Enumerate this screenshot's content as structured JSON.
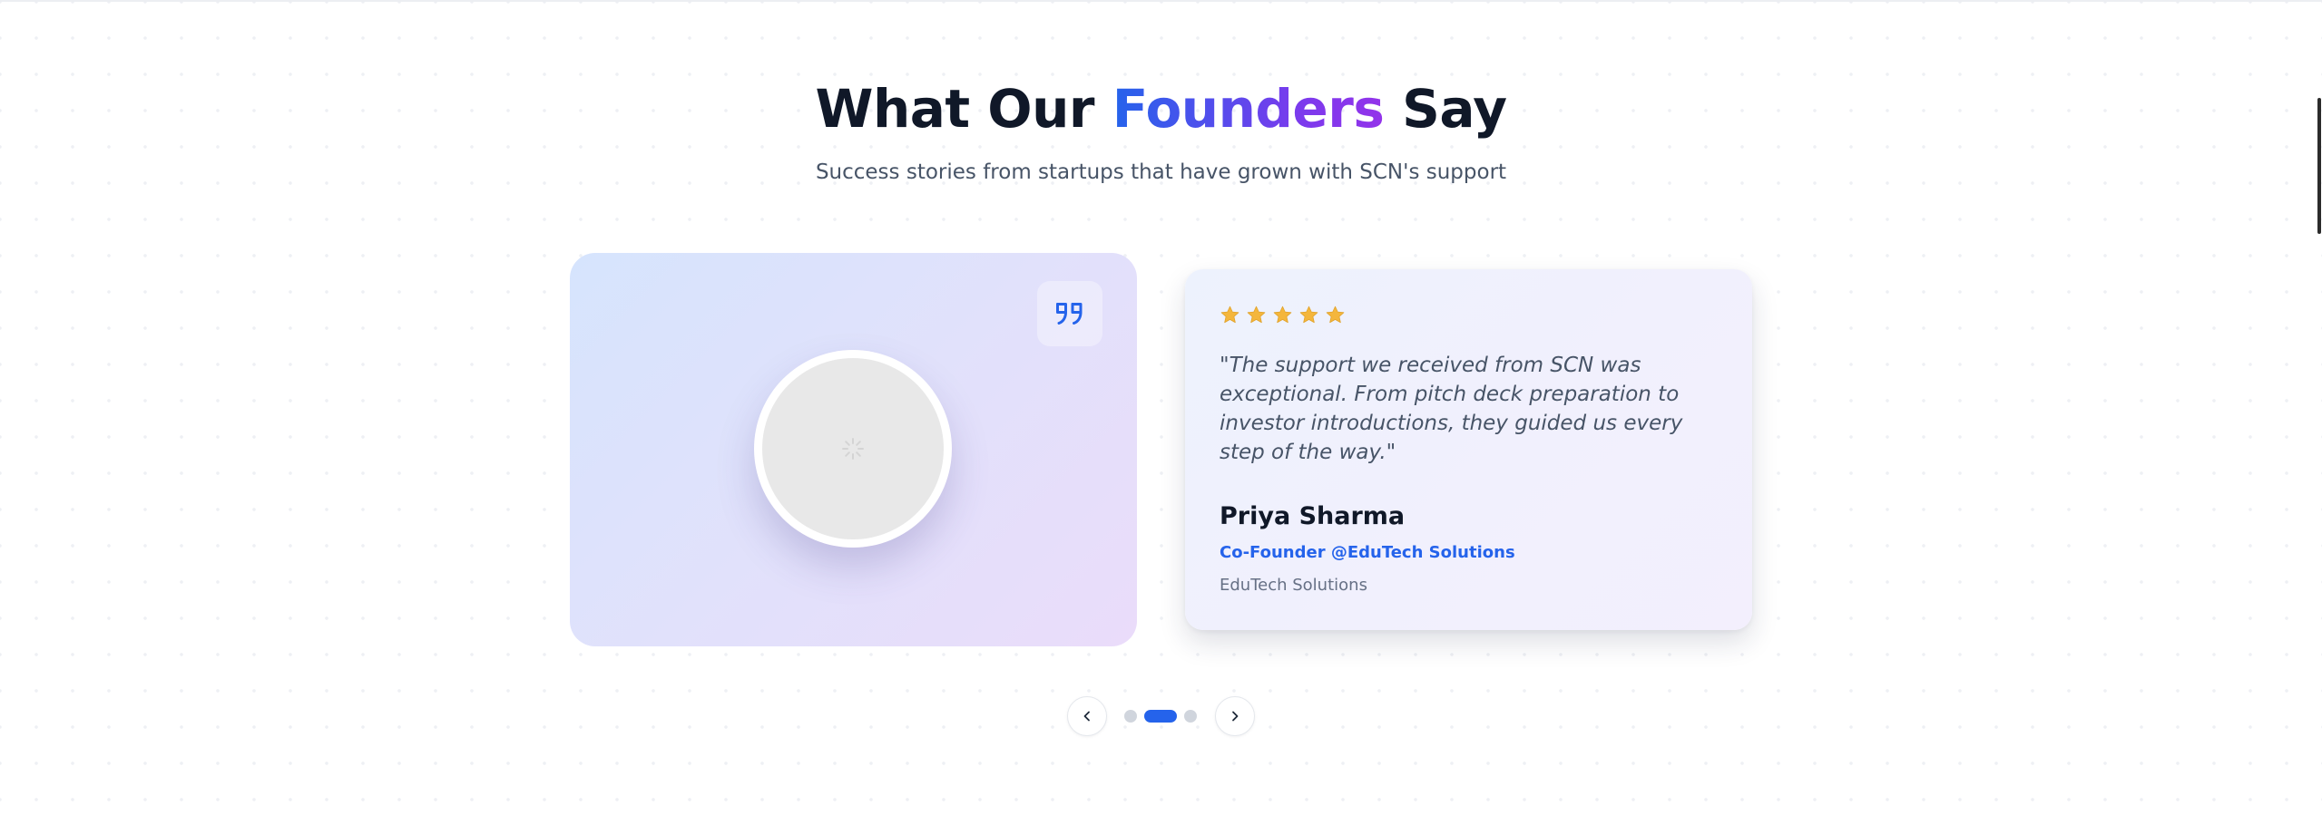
{
  "section": {
    "heading": {
      "before": "What Our ",
      "highlight": "Founders",
      "after": " Say"
    },
    "subtitle": "Success stories from startups that have grown with SCN's support"
  },
  "testimonial": {
    "rating": 5,
    "quote": "\"The support we received from SCN was exceptional. From pitch deck preparation to investor introductions, they guided us every step of the way.\"",
    "name": "Priya Sharma",
    "role": "Co-Founder @EduTech Solutions",
    "company": "EduTech Solutions"
  },
  "carousel": {
    "total_slides": 3,
    "active_slide": 2
  },
  "icons": {
    "quote": "quote-icon",
    "star": "star-icon",
    "prev": "chevron-left-icon",
    "next": "chevron-right-icon",
    "loading": "loading-spinner-icon"
  },
  "colors": {
    "accent_blue": "#2563eb",
    "accent_purple": "#9333ea",
    "heading": "#101828",
    "star": "#f4b63c",
    "dot_inactive": "#d0d5dd"
  }
}
